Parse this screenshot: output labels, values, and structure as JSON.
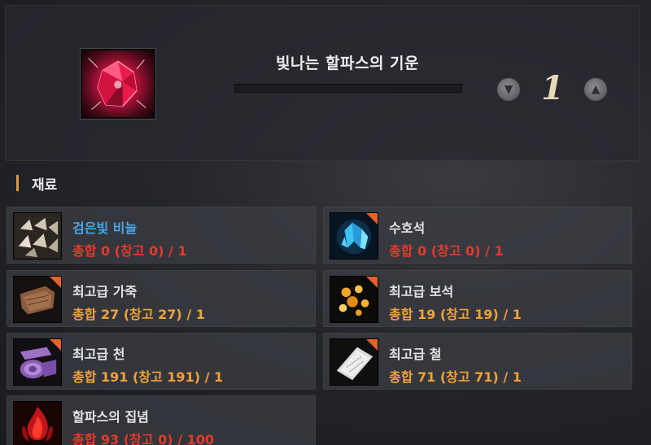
{
  "item": {
    "title": "빛나는 할파스의 기운",
    "quantity": "1",
    "quantity_fraction": 0,
    "icon": "pink-crystal-icon"
  },
  "controls": {
    "decrease_symbol": "▼",
    "increase_symbol": "▲"
  },
  "materials_section": {
    "title": "재료"
  },
  "materials": [
    {
      "name": "검은빛 비늘",
      "count": "총합 0 (창고 0) / 1",
      "name_color": "#49a6e8",
      "count_color": "#e43a2a",
      "icon": "black-scales-icon",
      "flag": false
    },
    {
      "name": "수호석",
      "count": "총합 0 (창고 0) / 1",
      "name_color": "#e4e4e4",
      "count_color": "#e43a2a",
      "icon": "blue-crystal-icon",
      "flag": true
    },
    {
      "name": "최고급 가죽",
      "count": "총합 27 (창고 27) / 1",
      "name_color": "#e4e4e4",
      "count_color": "#f0a23a",
      "icon": "leather-icon",
      "flag": true
    },
    {
      "name": "최고급 보석",
      "count": "총합 19 (창고 19) / 1",
      "name_color": "#e4e4e4",
      "count_color": "#f0a23a",
      "icon": "gems-icon",
      "flag": true
    },
    {
      "name": "최고급 천",
      "count": "총합 191 (창고 191) / 1",
      "name_color": "#e4e4e4",
      "count_color": "#f0a23a",
      "icon": "cloth-roll-icon",
      "flag": true
    },
    {
      "name": "최고급 철",
      "count": "총합 71 (창고 71) / 1",
      "name_color": "#e4e4e4",
      "count_color": "#f0a23a",
      "icon": "iron-plate-icon",
      "flag": true
    },
    {
      "name": "할파스의 집념",
      "count": "총합 93 (창고 0) / 100",
      "name_color": "#e4e4e4",
      "count_color": "#e43a2a",
      "icon": "red-flame-icon",
      "flag": false
    }
  ]
}
